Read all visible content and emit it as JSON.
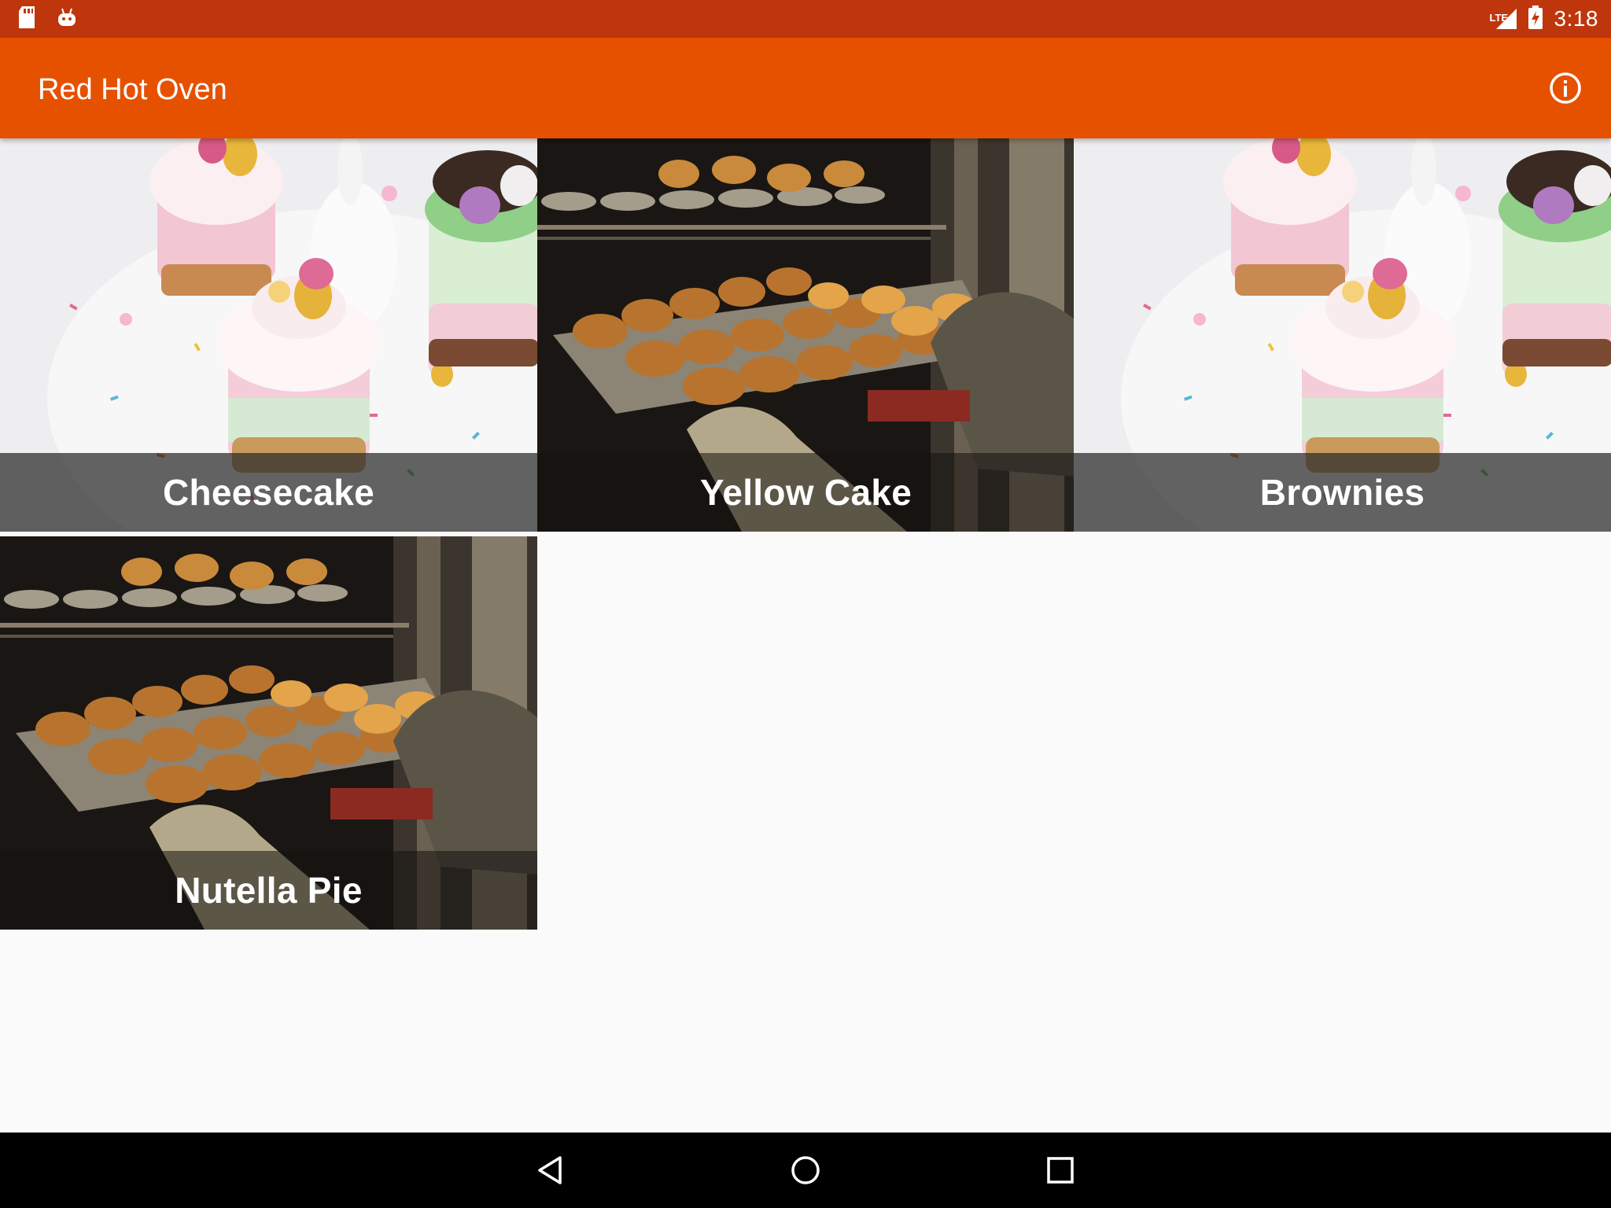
{
  "status_bar": {
    "time": "3:18",
    "network_label": "LTE",
    "icons": [
      "sd-card-icon",
      "android-debug-icon",
      "signal-icon",
      "battery-charging-icon"
    ]
  },
  "app_bar": {
    "title": "Red Hot Oven",
    "info_icon": "info-icon"
  },
  "recipes": [
    {
      "name": "Cheesecake",
      "image": "easter-cupcakes"
    },
    {
      "name": "Yellow Cake",
      "image": "muffins-oven"
    },
    {
      "name": "Brownies",
      "image": "easter-cupcakes"
    },
    {
      "name": "Nutella Pie",
      "image": "muffins-oven"
    }
  ],
  "nav_bar": {
    "icons": [
      "back-icon",
      "home-icon",
      "recents-icon"
    ]
  },
  "colors": {
    "status_bar": "#bf360c",
    "app_bar": "#e65100",
    "background": "#fafafa",
    "caption_overlay": "#282828"
  }
}
